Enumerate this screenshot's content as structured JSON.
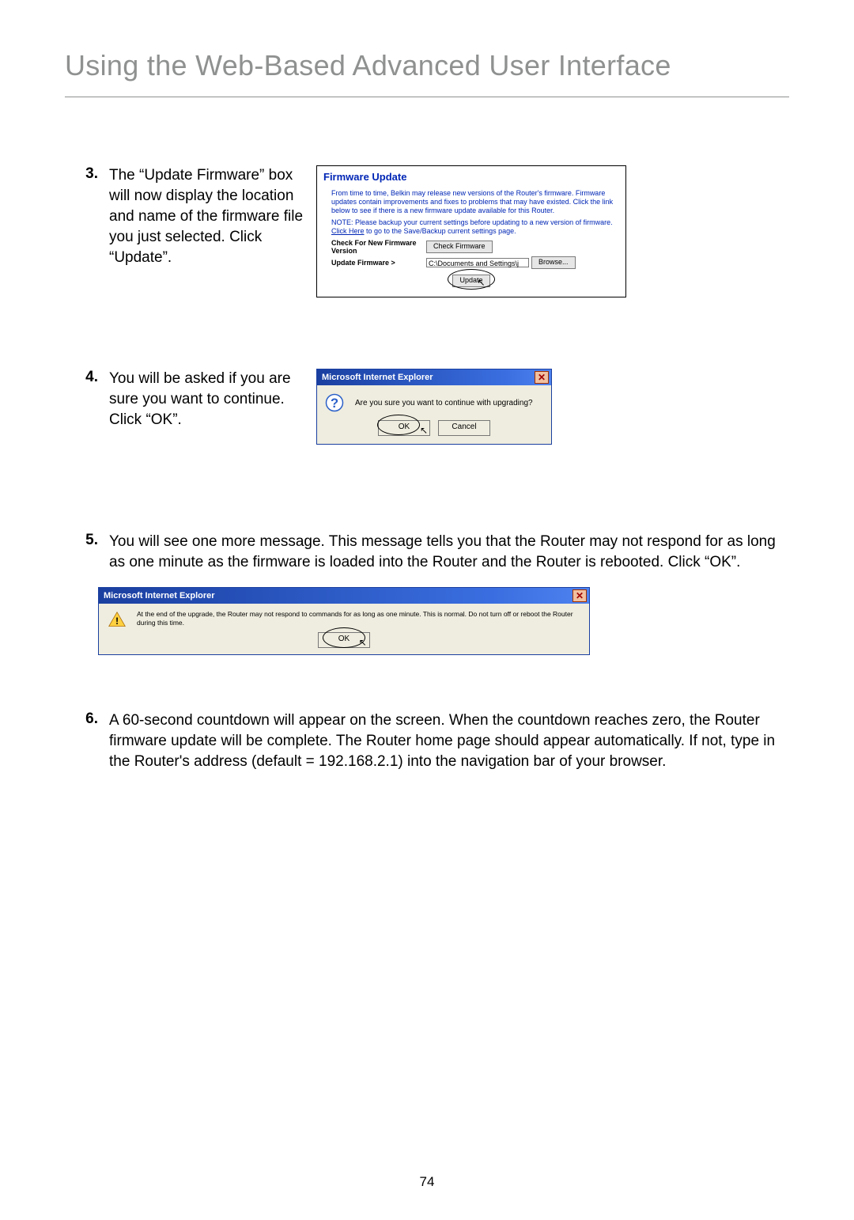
{
  "pageTitle": "Using the Web-Based Advanced User Interface",
  "pageNumber": "74",
  "steps": {
    "s3": {
      "num": "3.",
      "text": "The “Update Firmware” box will now display the location and name of the firmware file you just selected. Click “Update”."
    },
    "s4": {
      "num": "4.",
      "text": "You will be asked if you are sure you want to continue. Click “OK”."
    },
    "s5": {
      "num": "5.",
      "text": "You will see one more message. This message tells you that the Router may not respond for as long as one minute as the firmware is loaded into the Router and the Router is rebooted. Click “OK”."
    },
    "s6": {
      "num": "6.",
      "text": "A 60-second countdown will appear on the screen. When the countdown reaches zero, the Router firmware update will be complete. The Router home page should appear automatically. If not, type in the Router's address (default = 192.168.2.1) into the navigation bar of your browser."
    }
  },
  "fw": {
    "title": "Firmware Update",
    "para1": "From time to time, Belkin may release new versions of the Router's firmware. Firmware updates contain improvements and fixes to problems that may have existed. Click the link below to see if there is a new firmware update available for this Router.",
    "note": "NOTE: Please backup your current settings before updating to a new version of firmware. ",
    "noteLinkText": "Click Here",
    "noteTail": " to go to the Save/Backup current settings page.",
    "checkLabel": "Check For New Firmware Version",
    "checkBtn": "Check Firmware",
    "updateLabel": "Update Firmware >",
    "pathValue": "C:\\Documents and Settings\\j",
    "browseBtn": "Browse...",
    "updateBtn": "Update"
  },
  "dlg1": {
    "title": "Microsoft Internet Explorer",
    "msg": "Are you sure you want to continue with upgrading?",
    "ok": "OK",
    "cancel": "Cancel"
  },
  "dlg2": {
    "title": "Microsoft Internet Explorer",
    "msg": "At the end of the upgrade, the Router may not respond to commands for as long as one minute. This is normal. Do not turn off or reboot the Router during this time.",
    "ok": "OK"
  }
}
